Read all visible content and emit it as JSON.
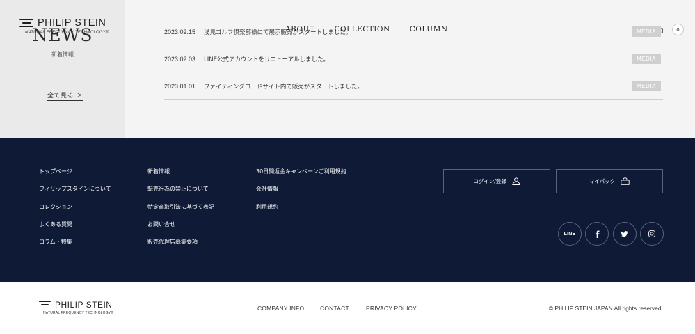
{
  "header": {
    "logo_wordmark": "PHILIP STEIN",
    "logo_tagline": "NATURAL FREQUENCY TECHNOLOGY®",
    "nav": [
      "ABOUT",
      "COLLECTION",
      "COLUMN"
    ],
    "icons": [
      "user-icon",
      "bag-icon"
    ],
    "cart_count": "0"
  },
  "news": {
    "heading": "NEWS",
    "subheading": "新着情報",
    "view_all": "全て見る ＞",
    "items": [
      {
        "date": "2023.02.15",
        "title": "浅見ゴルフ倶楽部様にて展示販売がスタートしました。",
        "tag": "MEDIA"
      },
      {
        "date": "2023.02.03",
        "title": "LINE公式アカウントをリニューアルしました。",
        "tag": "MEDIA"
      },
      {
        "date": "2023.01.01",
        "title": "ファイティングロードサイト内で販売がスタートしました。",
        "tag": "MEDIA"
      }
    ]
  },
  "footer": {
    "col1": [
      "トップページ",
      "フィリップスタインについて",
      "コレクション",
      "よくある質問",
      "コラム・特集"
    ],
    "col2": [
      "新着情報",
      "転売行為の禁止について",
      "特定商取引法に基づく表記",
      "お問い合せ",
      "販売代理店募集要項"
    ],
    "col3": [
      "30日間返金キャンペーンご利用規約",
      "会社情報",
      "利用規約"
    ],
    "login_label": "ログイン/登録",
    "mypack_label": "マイパック",
    "social": {
      "line": "LINE"
    },
    "background": "#0e1a36"
  },
  "bottom": {
    "logo_wordmark": "PHILIP STEIN",
    "logo_tagline": "NATURAL FREQUENCY TECHNOLOGY®",
    "links": [
      "COMPANY INFO",
      "CONTACT",
      "PRIVACY POLICY"
    ],
    "copyright": "© PHILIP STEIN JAPAN All rights reserved."
  }
}
